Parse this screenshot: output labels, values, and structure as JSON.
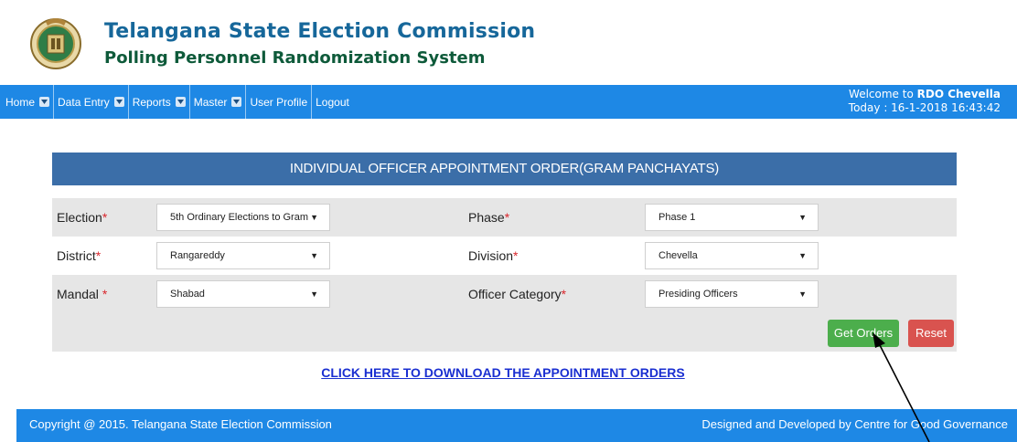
{
  "header": {
    "title": "Telangana State Election Commission",
    "subtitle": "Polling Personnel Randomization System",
    "logo_icon": "emblem-logo"
  },
  "nav": {
    "items": [
      {
        "label": "Home",
        "dropdown": true
      },
      {
        "label": "Data Entry",
        "dropdown": true
      },
      {
        "label": "Reports",
        "dropdown": true
      },
      {
        "label": "Master",
        "dropdown": true
      },
      {
        "label": "User Profile",
        "dropdown": false
      },
      {
        "label": "Logout",
        "dropdown": false
      }
    ],
    "welcome_prefix": "Welcome to",
    "welcome_user": "RDO Chevella",
    "today": "Today : 16-1-2018 16:43:42"
  },
  "panel": {
    "heading": "INDIVIDUAL OFFICER APPOINTMENT ORDER(GRAM PANCHAYATS)"
  },
  "form": {
    "election_label": "Election",
    "election_value": "5th Ordinary Elections to Gram",
    "phase_label": "Phase",
    "phase_value": "Phase 1",
    "district_label": "District",
    "district_value": "Rangareddy",
    "division_label": "Division",
    "division_value": "Chevella",
    "mandal_label": "Mandal ",
    "mandal_value": "Shabad",
    "officer_category_label": "Officer Category",
    "officer_category_value": "Presiding Officers",
    "required_mark": "*"
  },
  "buttons": {
    "get_orders": "Get Orders",
    "reset": "Reset"
  },
  "download_link": "CLICK HERE TO DOWNLOAD THE APPOINTMENT ORDERS",
  "footer": {
    "copyright": "Copyright @ 2015. Telangana State Election Commission",
    "credit": "Designed and Developed by Centre for Good Governance"
  },
  "colors": {
    "nav_bg": "#1e88e5",
    "panel_heading_bg": "#3b6ea8",
    "title": "#16679a",
    "subtitle": "#0e5a3a",
    "get_orders_bg": "#4cae4c",
    "reset_bg": "#d9534f",
    "required": "#d9262c",
    "link": "#1a2fd1"
  }
}
